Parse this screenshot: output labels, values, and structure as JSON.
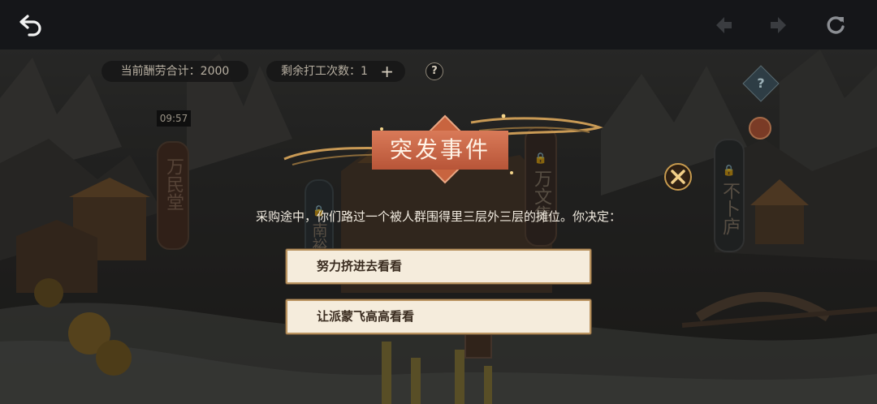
{
  "toolbar": {
    "back_icon": "back-arrow-icon",
    "prev_icon": "nav-back-icon",
    "next_icon": "nav-forward-icon",
    "refresh_icon": "refresh-icon"
  },
  "hud": {
    "payment_total": "当前酬劳合计：2000",
    "remaining_work": "剩余打工次数：1",
    "add_symbol": "+",
    "help_symbol": "?",
    "timer": "09:57",
    "side_help_symbol": "?"
  },
  "signs": {
    "wanmin": "万民堂",
    "wanwen": "万文集",
    "buxia": "不卜庐",
    "chunan": "南裕"
  },
  "event": {
    "title": "突发事件",
    "description": "采购途中，你们路过一个被人群围得里三层外三层的摊位。你决定：",
    "choices": [
      {
        "label": "努力挤进去看看"
      },
      {
        "label": "让派蒙飞高高看看"
      }
    ]
  },
  "colors": {
    "topbar": "#151619",
    "title_banner": "#c8643f",
    "choice_bg": "#f5ecdc",
    "choice_border": "#b9935f"
  }
}
